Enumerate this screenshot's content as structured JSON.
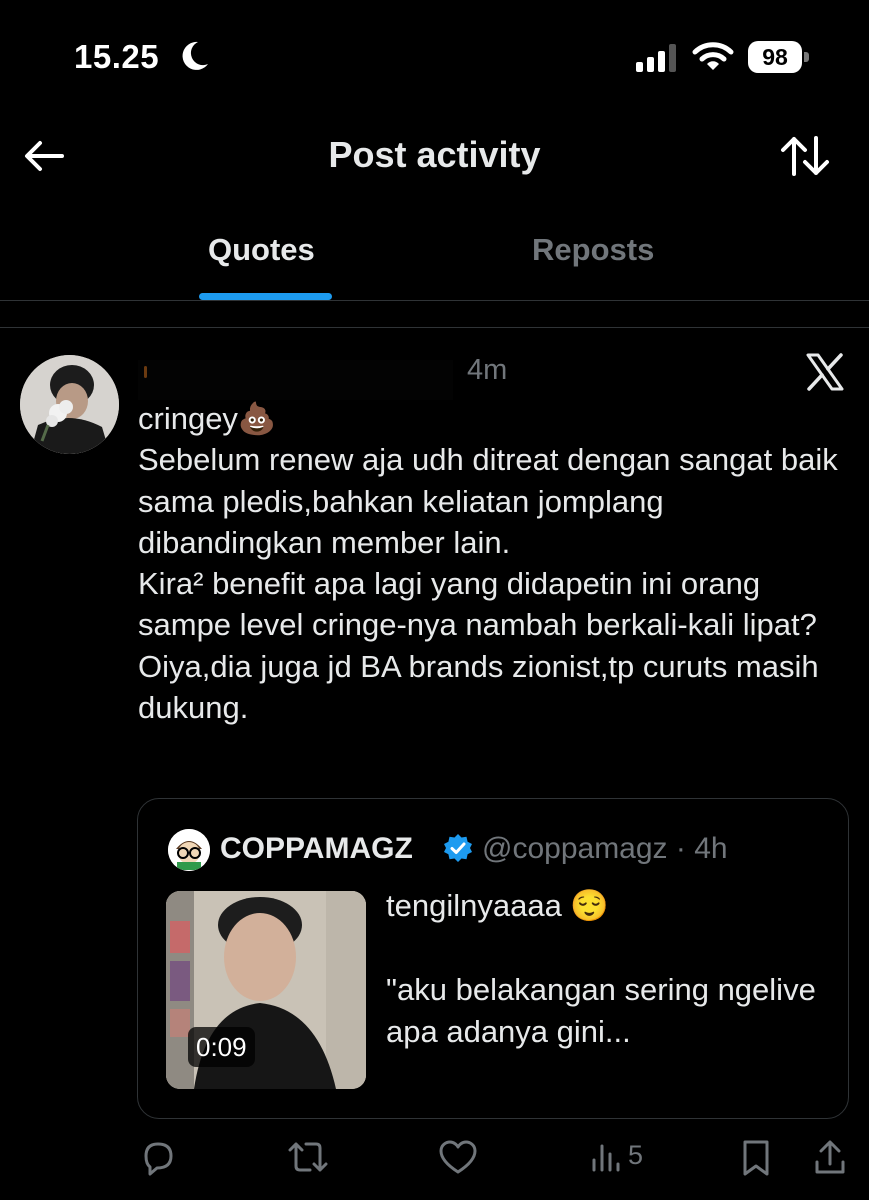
{
  "status_bar": {
    "time": "15.25",
    "battery": "98"
  },
  "header": {
    "title": "Post activity"
  },
  "tabs": [
    {
      "label": "Quotes",
      "active": true
    },
    {
      "label": "Reposts",
      "active": false
    }
  ],
  "post": {
    "timestamp": "4m",
    "text": "cringey💩\nSebelum renew aja udh ditreat dengan sangat baik sama pledis,bahkan keliatan jomplang dibandingkan member lain.\nKira² benefit apa lagi yang didapetin ini orang sampe level cringe-nya nambah berkali-kali lipat?\nOiya,dia juga jd BA brands zionist,tp curuts masih dukung.",
    "quote": {
      "name": "COPPAMAGZ",
      "handle_time": "@coppamagz · 4h",
      "text": "tengilnyaaaa 😌\n\n\"aku belakangan sering ngelive apa adanya gini...",
      "video_duration": "0:09"
    },
    "actions": {
      "views": "5"
    }
  },
  "colors": {
    "accent": "#1d9bf0",
    "background": "#000000",
    "muted": "#71767b",
    "text": "#e7e9ea"
  },
  "icons": [
    "moon-icon",
    "signal-icon",
    "wifi-icon",
    "back-arrow-icon",
    "sort-icon",
    "x-logo-icon",
    "verified-badge-icon",
    "reply-icon",
    "repost-icon",
    "like-icon",
    "views-icon",
    "bookmark-icon",
    "share-icon"
  ]
}
